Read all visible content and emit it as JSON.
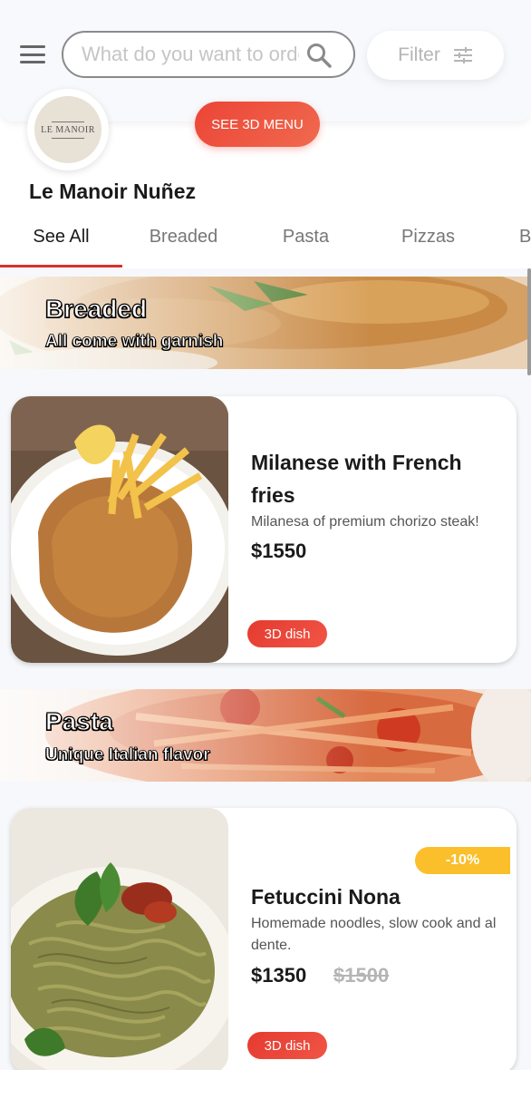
{
  "header": {
    "search_placeholder": "What do you want to order?",
    "filter_label": "Filter",
    "see_3d_menu": "SEE 3D MENU"
  },
  "restaurant": {
    "logo_text": "LE MANOIR",
    "name": "Le Manoir Nuñez"
  },
  "tabs": [
    {
      "label": "See All",
      "active": true
    },
    {
      "label": "Breaded",
      "active": false
    },
    {
      "label": "Pasta",
      "active": false
    },
    {
      "label": "Pizzas",
      "active": false
    },
    {
      "label": "B",
      "active": false
    }
  ],
  "sections": [
    {
      "title": "Breaded",
      "subtitle": "All come with garnish",
      "items": [
        {
          "name": "Milanese with French fries",
          "description": "Milanesa of premium chorizo steak!",
          "price": "$1550",
          "badge": "3D dish"
        }
      ]
    },
    {
      "title": "Pasta",
      "subtitle": "Unique Italian flavor",
      "items": [
        {
          "name": "Fetuccini Nona",
          "description": "Homemade noodles, slow cook and al dente.",
          "price": "$1350",
          "old_price": "$1500",
          "discount": "-10%",
          "badge": "3D dish"
        }
      ]
    }
  ],
  "colors": {
    "accent": "#e53a30",
    "discount": "#fbbf2b",
    "background": "#f6f8fb"
  }
}
